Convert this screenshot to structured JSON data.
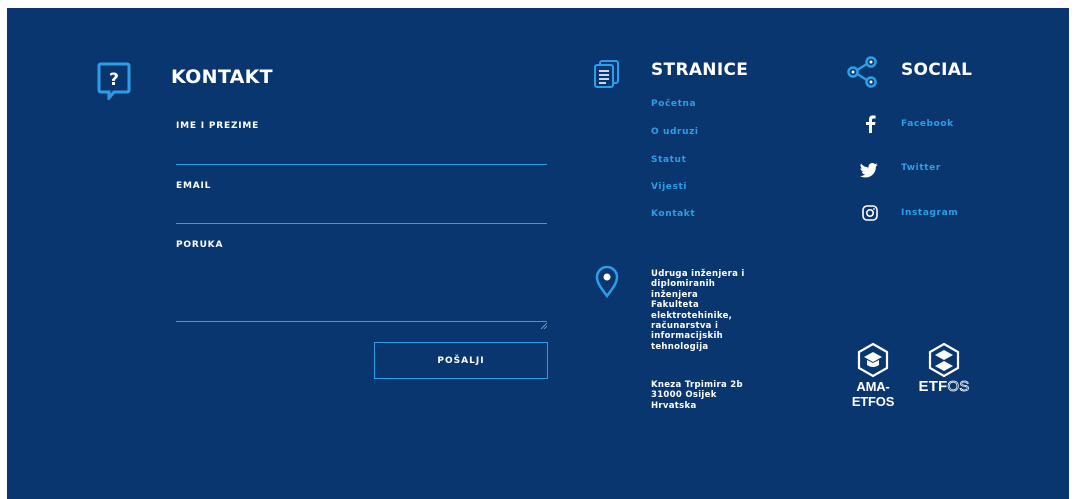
{
  "contact": {
    "title": "KONTAKT",
    "name_label": "IME I PREZIME",
    "email_label": "EMAIL",
    "message_label": "PORUKA",
    "submit_label": "POŠALJI"
  },
  "pages": {
    "title": "STRANICE",
    "links": [
      "Početna",
      "O udruzi",
      "Statut",
      "Vijesti",
      "Kontakt"
    ]
  },
  "social": {
    "title": "SOCIAL",
    "links": [
      "Facebook",
      "Twitter",
      "Instagram"
    ]
  },
  "address": {
    "org_lines": [
      "Udruga inženjera i",
      "diplomiranih",
      "inženjera",
      "Fakulteta",
      "elektrotehinike,",
      "računarstva i",
      "informacijskih",
      "tehnologija"
    ],
    "street_lines": [
      "Kneza Trpimira 2b",
      "31000 Osijek",
      "Hrvatska"
    ]
  },
  "logos": {
    "ama": "AMA-ETFOS",
    "etf_bold": "ETF",
    "etf_light": "OS"
  },
  "colors": {
    "background": "#0a3670",
    "accent": "#2a9fe8",
    "text": "#ffffff"
  },
  "icons": {
    "contact": "question-bubble-icon",
    "pages": "document-icon",
    "social": "share-icon",
    "location": "map-pin-icon"
  }
}
